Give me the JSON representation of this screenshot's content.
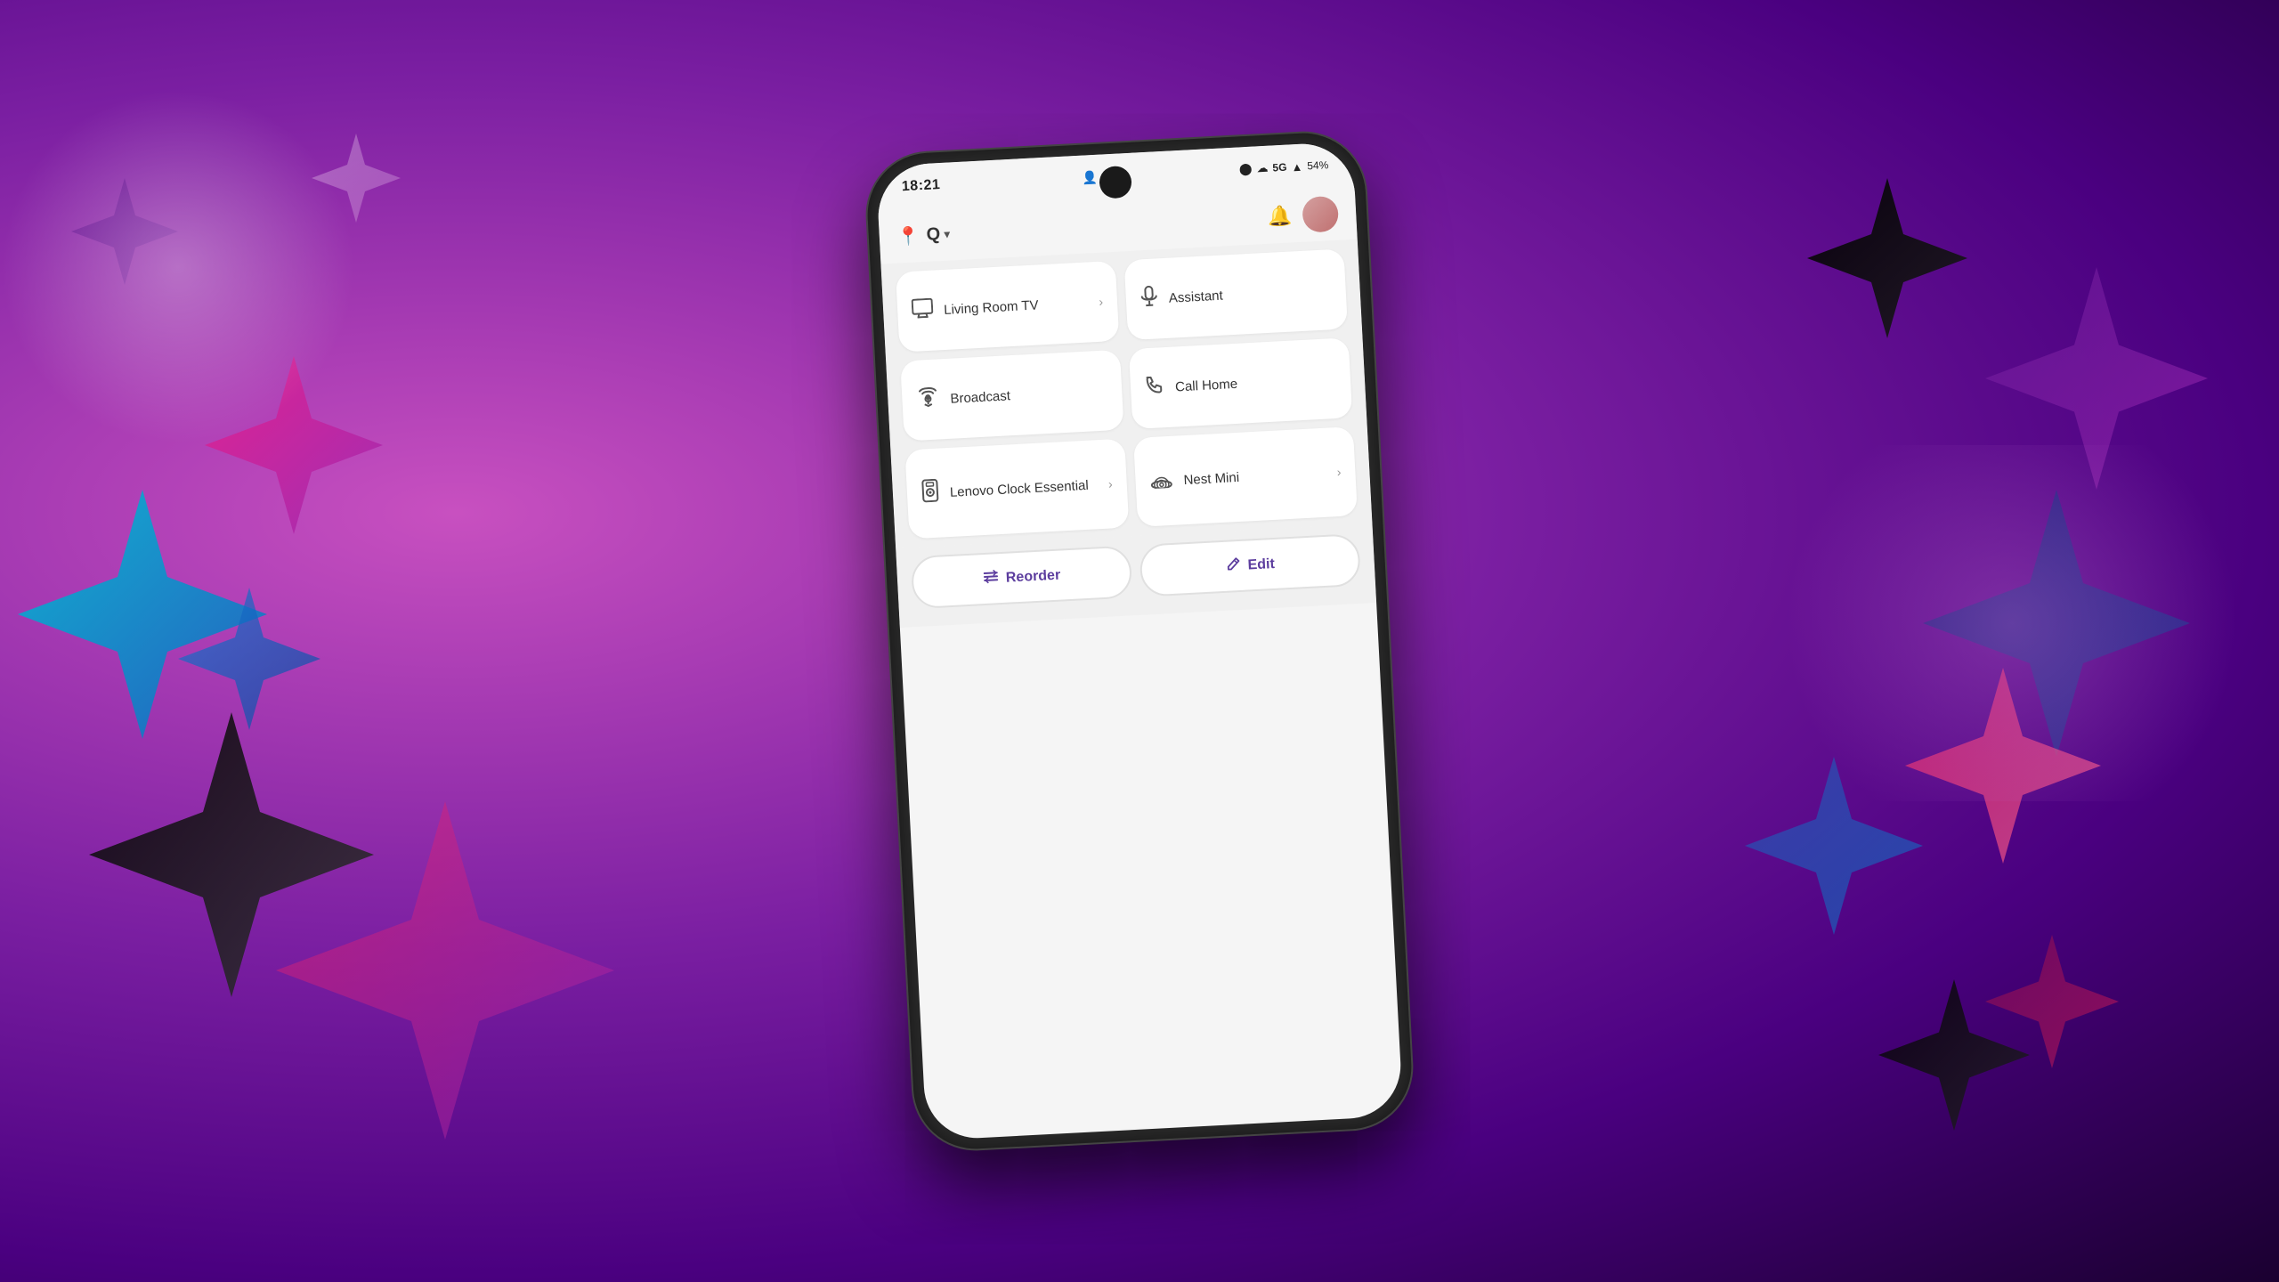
{
  "background": {
    "description": "Purple gradient with sparkle stars"
  },
  "status_bar": {
    "time": "18:21",
    "icons": "🔵 ☁ 5G ▲ 54%"
  },
  "top_bar": {
    "location_icon": "📍",
    "search_label": "Q",
    "chevron": "▾",
    "bell_icon": "🔔"
  },
  "cards": [
    {
      "id": "living-room-tv",
      "label": "Living Room TV",
      "icon": "tv",
      "has_chevron": true
    },
    {
      "id": "assistant",
      "label": "Assistant",
      "icon": "mic",
      "has_chevron": false
    },
    {
      "id": "broadcast",
      "label": "Broadcast",
      "icon": "broadcast",
      "has_chevron": false
    },
    {
      "id": "call-home",
      "label": "Call Home",
      "icon": "phone",
      "has_chevron": false
    },
    {
      "id": "lenovo-clock",
      "label": "Lenovo Clock Essential",
      "icon": "speaker",
      "has_chevron": true
    },
    {
      "id": "nest-mini",
      "label": "Nest Mini",
      "icon": "speaker-mini",
      "has_chevron": true
    }
  ],
  "buttons": [
    {
      "id": "reorder",
      "label": "Reorder",
      "icon": "reorder"
    },
    {
      "id": "edit",
      "label": "Edit",
      "icon": "edit"
    }
  ]
}
